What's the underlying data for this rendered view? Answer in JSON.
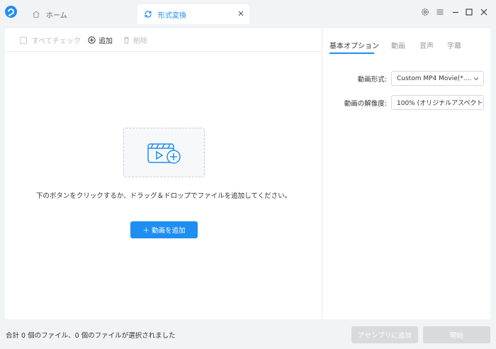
{
  "tabs": {
    "home_label": "ホーム",
    "convert_label": "形式変換"
  },
  "toolbar": {
    "check_all_label": "すべてチェック",
    "add_label": "追加",
    "delete_label": "削除"
  },
  "dropzone": {
    "hint": "下のボタンをクリックするか、ドラッグ＆ドロップでファイルを追加してください。",
    "add_button_label": "＋ 動画を追加"
  },
  "options": {
    "tabs": [
      "基本オプション",
      "動画",
      "音声",
      "字幕"
    ],
    "format_label": "動画形式:",
    "format_value": "Custom MP4 Movie(*....",
    "resolution_label": "動画の解像度:",
    "resolution_value": "100% (オリジナルアスペクト"
  },
  "status": {
    "summary": "合計 0 個のファイル、0 個のファイルが選択されました",
    "assembly_label": "アセンブリに追加",
    "start_label": "開始"
  },
  "colors": {
    "accent": "#1f8ef1",
    "disabled_button": "#d9dadc",
    "background": "#f2f3f5"
  }
}
